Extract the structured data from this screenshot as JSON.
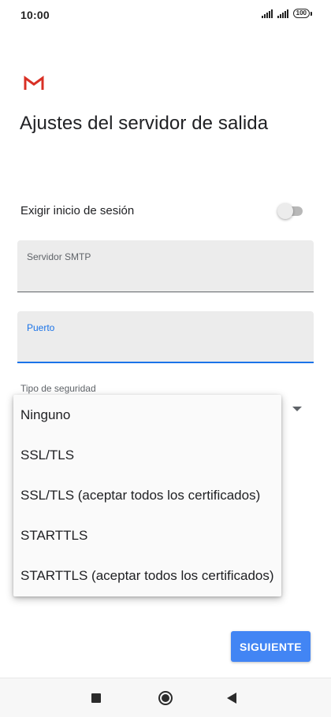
{
  "status_bar": {
    "time": "10:00",
    "battery": "100"
  },
  "logo": {
    "icon": "gmail-icon",
    "color": "#d93025"
  },
  "title": "Ajustes del servidor de salida",
  "signin_toggle": {
    "label": "Exigir inicio de sesión",
    "enabled": false
  },
  "fields": {
    "smtp": {
      "label": "Servidor SMTP",
      "value": ""
    },
    "port": {
      "label": "Puerto",
      "value": ""
    }
  },
  "security": {
    "label": "Tipo de seguridad",
    "options": [
      "Ninguno",
      "SSL/TLS",
      "SSL/TLS (aceptar todos los certificados)",
      "STARTTLS",
      "STARTTLS (aceptar todos los certificados)"
    ]
  },
  "next_button": {
    "label": "SIGUIENTE",
    "color": "#4285f4"
  },
  "nav": {
    "recent_icon": "square-icon",
    "home_icon": "circle-icon",
    "back_icon": "back-triangle-icon"
  },
  "colors": {
    "accent": "#1a73e8",
    "field_bg": "#ececec"
  }
}
